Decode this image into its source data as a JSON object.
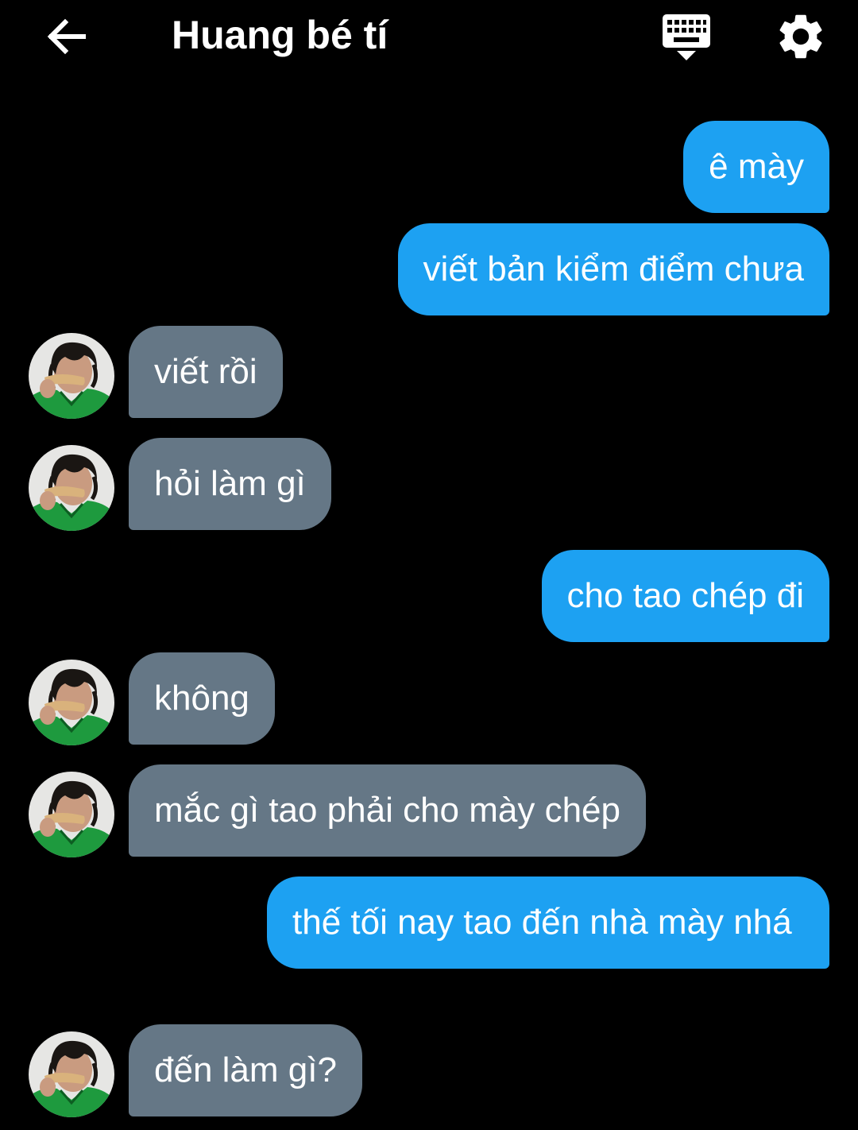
{
  "header": {
    "title": "Huang bé tí",
    "back_icon": "arrow-left-icon",
    "keyboard_icon": "keyboard-hide-icon",
    "settings_icon": "gear-icon"
  },
  "colors": {
    "background": "#000000",
    "outgoing_bubble": "#1da1f2",
    "incoming_bubble": "#657786",
    "text": "#ffffff"
  },
  "messages": [
    {
      "direction": "outgoing",
      "text": "ê mày"
    },
    {
      "direction": "outgoing",
      "text": "viết bản kiểm điểm chưa"
    },
    {
      "direction": "incoming",
      "text": "viết rồi"
    },
    {
      "direction": "incoming",
      "text": "hỏi làm gì"
    },
    {
      "direction": "outgoing",
      "text": "cho tao chép đi"
    },
    {
      "direction": "incoming",
      "text": "không"
    },
    {
      "direction": "incoming",
      "text": "mắc gì tao phải cho mày chép"
    },
    {
      "direction": "outgoing",
      "text": "thế tối nay tao đến nhà mày nhá"
    },
    {
      "direction": "incoming",
      "text": "đến làm gì?"
    }
  ]
}
